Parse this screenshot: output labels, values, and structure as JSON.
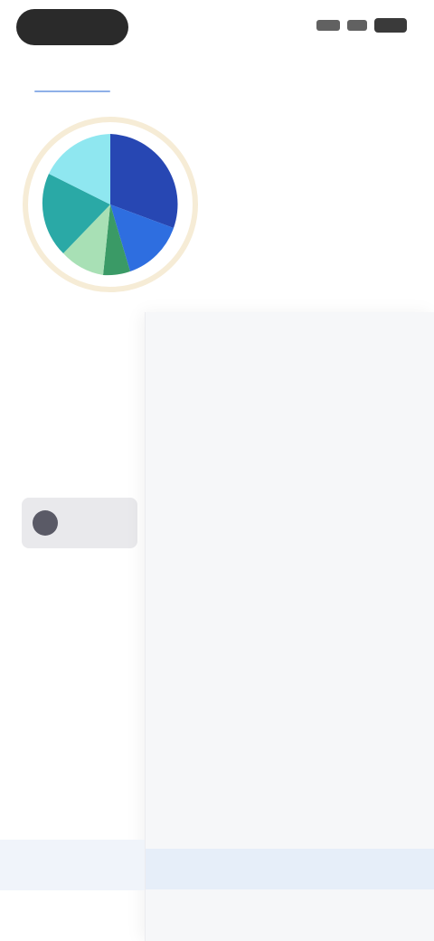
{
  "status_bar": {
    "time": ""
  },
  "tabs": [
    {
      "label": ""
    },
    {
      "label": ""
    }
  ],
  "summary": {
    "title": "",
    "subtitle": "",
    "line": "",
    "card_text": ""
  },
  "dropdown": {
    "header": "",
    "items": [
      "",
      "",
      "",
      "",
      "",
      "",
      "",
      "",
      "",
      "",
      "",
      "",
      ""
    ],
    "selected_index": 11
  },
  "bottom_bar": {
    "cancel_label": "",
    "ok_label": ""
  },
  "colors": {
    "accent": "#4a74c9",
    "chart_dark_blue": "#2747b3",
    "chart_blue": "#2e6ee0",
    "chart_teal": "#2aa9a6",
    "chart_cyan": "#8fe7f0",
    "chart_green": "#3a9a66",
    "chart_light_green": "#a8e0b5",
    "chart_cream": "#f6ecd6"
  }
}
